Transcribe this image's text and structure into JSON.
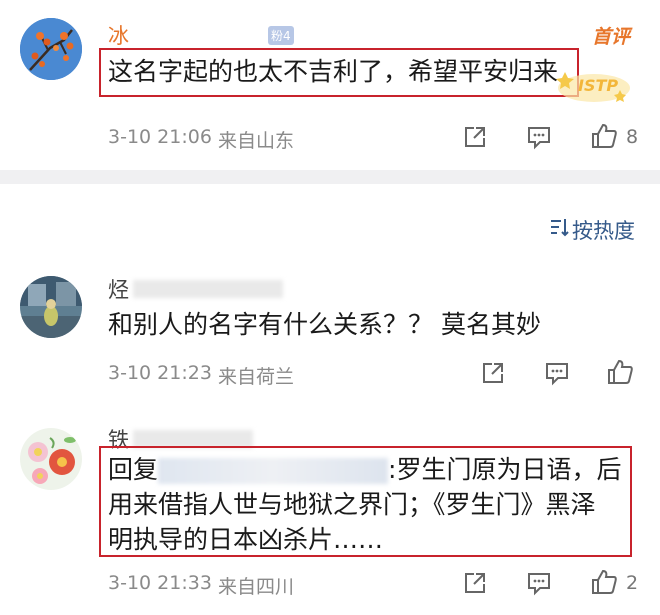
{
  "comments": [
    {
      "username": "冰",
      "fan_badge": "粉4",
      "featured_label": "首评",
      "text": "这名字起的也太不吉利了，希望平安归来",
      "time": "3-10 21:06",
      "location": "来自山东",
      "like_count": "8",
      "sticker_text": "ISTP"
    },
    {
      "username": "烃",
      "text": "和别人的名字有什么关系？？ 莫名其妙",
      "time": "3-10 21:23",
      "location": "来自荷兰",
      "like_count": ""
    },
    {
      "username": "铁",
      "reply_prefix": "回复",
      "text_line1_after": ":罗生门原为日语，后",
      "text_line2": "用来借指人世与地狱之界门；《罗生门》黑泽",
      "text_line3": "明执导的日本凶杀片……",
      "time": "3-10 21:33",
      "location": "来自四川",
      "like_count": "2"
    }
  ],
  "sort_label": "按热度",
  "colors": {
    "highlight_border": "#c8232c",
    "featured": "#e7762b",
    "sort": "#355a8a"
  }
}
